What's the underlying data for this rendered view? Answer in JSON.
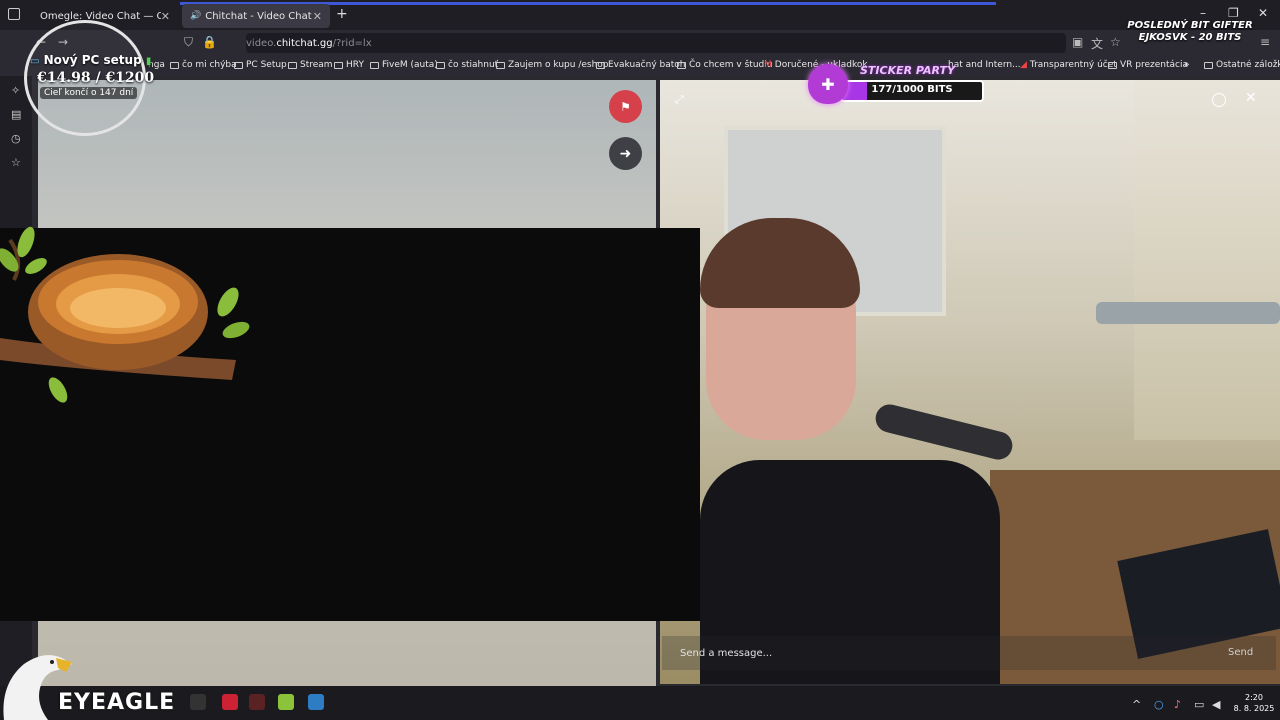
{
  "browser": {
    "tabs": [
      {
        "title": "Omegle: Video Chat — Omegle",
        "close": "✕"
      },
      {
        "title": "Chitchat - Video Chat",
        "close": "✕"
      }
    ],
    "new_tab": "+",
    "url": {
      "prefix": "video.",
      "host": "chitchat.gg",
      "path": "/?rid=lx"
    },
    "window_controls": [
      "–",
      "❐",
      "✕"
    ],
    "bookmarks": [
      "nga",
      "čo mi chýba",
      "PC Setup",
      "Stream",
      "HRY",
      "FiveM (auta)",
      "čo stiahnuť",
      "Zaujem o kupu /eshop",
      "Evakuačný batoh",
      "Čo chcem v študiu",
      "Doručené - ukladkok...",
      "hat and Intern...",
      "Transparentný účet",
      "VR prezentácia",
      "»",
      "Ostatné záložky"
    ]
  },
  "chat": {
    "message_placeholder": "Send a message...",
    "send_label": "Send"
  },
  "overlay": {
    "goal_title": "Nový PC setup",
    "goal_amount": "€14.98 / €1200",
    "goal_days": "Cieľ končí o 147 dní",
    "sticker_label": "STICKER PARTY",
    "sticker_count": "177/1000 BITS",
    "sticker_progress": 0.177,
    "gifter_line1": "POSLEDNÝ BIT GIFTER",
    "gifter_line2": "EJKOSVK - 20 BITS",
    "brand": "EYEAGLE"
  },
  "taskbar": {
    "time": "2:20",
    "date": "8. 8. 2025"
  },
  "colors": {
    "accent": "#3d57d6",
    "report": "#d6404a",
    "sticker": "#a936e6"
  }
}
